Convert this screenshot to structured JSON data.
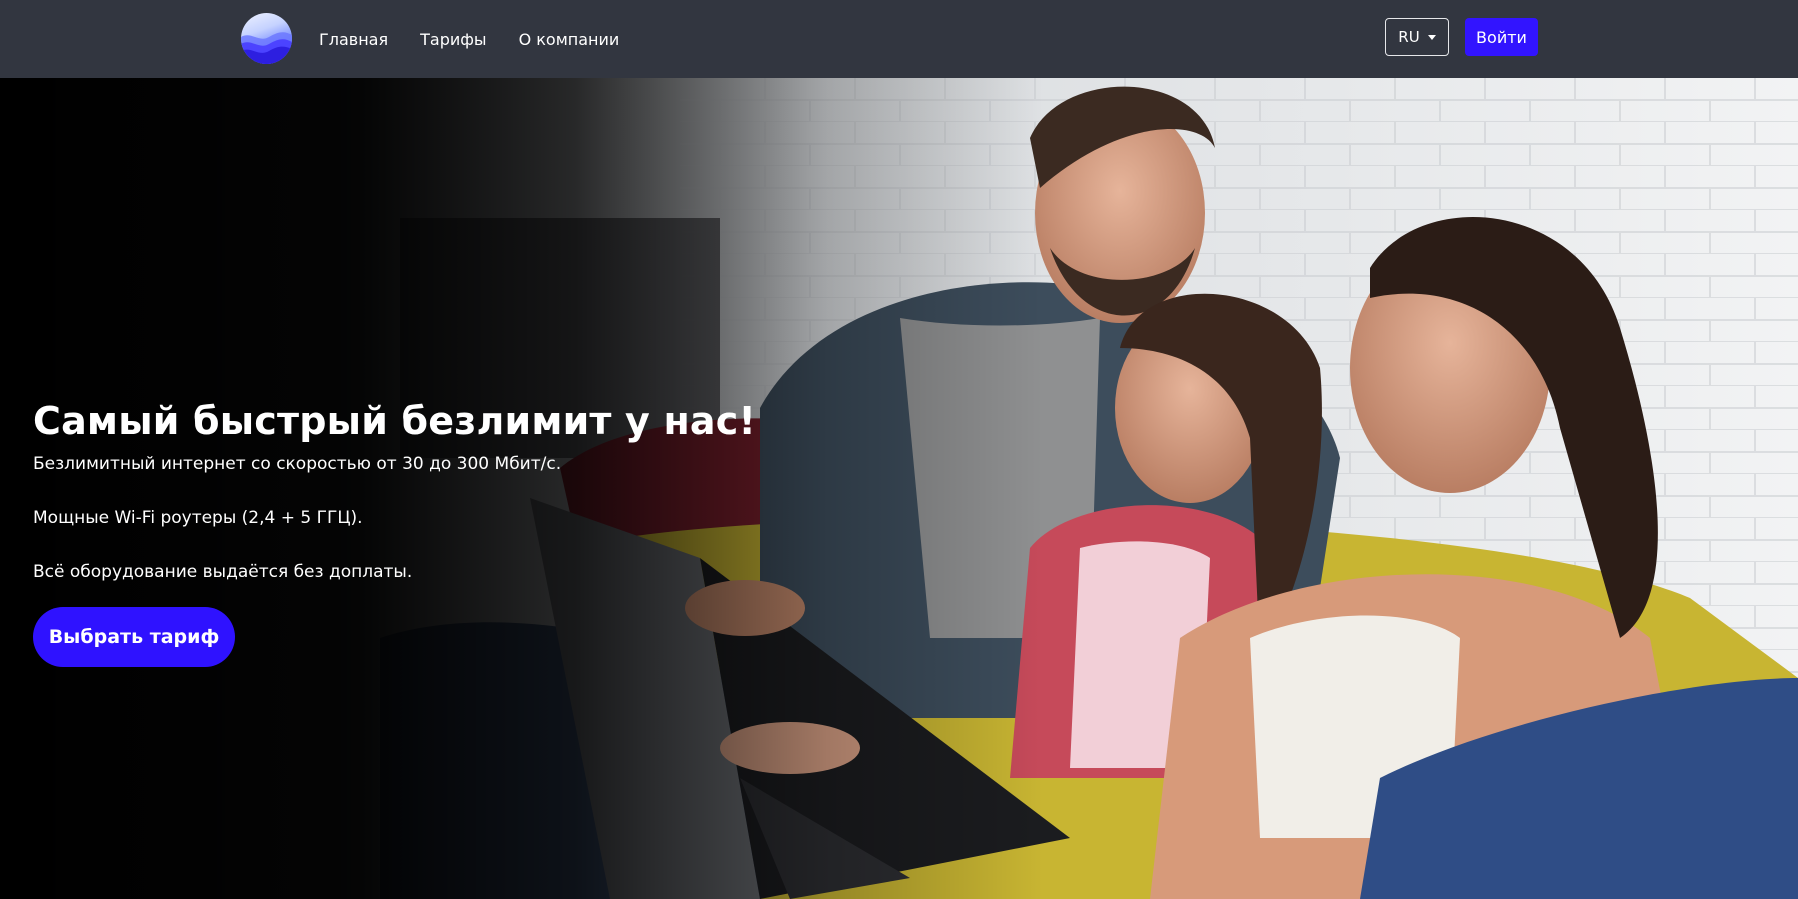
{
  "header": {
    "logo_icon": "globe-wave-icon",
    "nav": [
      "Главная",
      "Тарифы",
      "О компании"
    ],
    "language": "RU",
    "login_label": "Войти"
  },
  "hero": {
    "title": "Самый быстрый безлимит у нас!",
    "lines": [
      "Безлимитный интернет со скоростью от 30 до 300 Мбит/с.",
      "Мощные Wi-Fi роутеры (2,4 + 5 ГГЦ).",
      "Всё оборудование выдаётся без доплаты."
    ],
    "cta_label": "Выбрать тариф",
    "image": "family-with-laptop-on-sofa-photo"
  },
  "colors": {
    "header_bg": "#323640",
    "accent": "#3214ff",
    "text": "#ffffff"
  }
}
